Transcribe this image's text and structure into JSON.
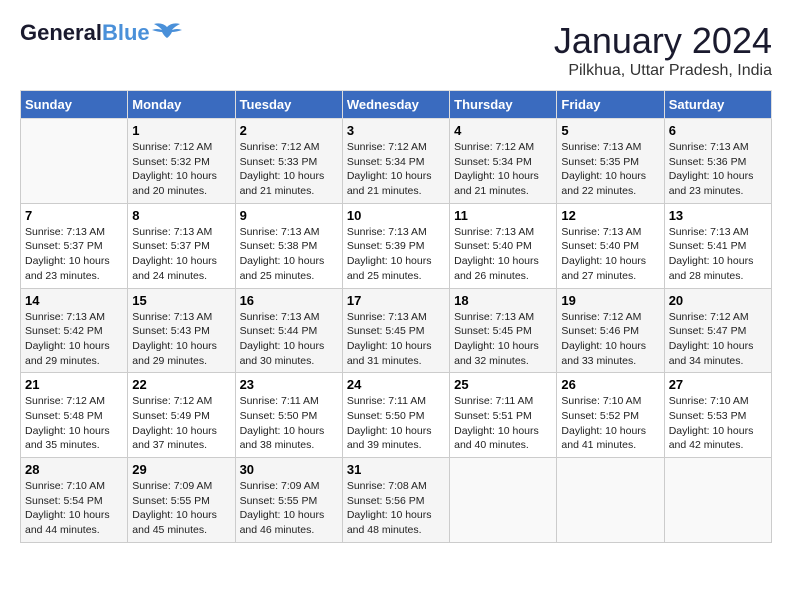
{
  "logo": {
    "part1": "General",
    "part2": "Blue"
  },
  "title": "January 2024",
  "location": "Pilkhua, Uttar Pradesh, India",
  "weekdays": [
    "Sunday",
    "Monday",
    "Tuesday",
    "Wednesday",
    "Thursday",
    "Friday",
    "Saturday"
  ],
  "weeks": [
    [
      {
        "date": "",
        "info": ""
      },
      {
        "date": "1",
        "info": "Sunrise: 7:12 AM\nSunset: 5:32 PM\nDaylight: 10 hours\nand 20 minutes."
      },
      {
        "date": "2",
        "info": "Sunrise: 7:12 AM\nSunset: 5:33 PM\nDaylight: 10 hours\nand 21 minutes."
      },
      {
        "date": "3",
        "info": "Sunrise: 7:12 AM\nSunset: 5:34 PM\nDaylight: 10 hours\nand 21 minutes."
      },
      {
        "date": "4",
        "info": "Sunrise: 7:12 AM\nSunset: 5:34 PM\nDaylight: 10 hours\nand 21 minutes."
      },
      {
        "date": "5",
        "info": "Sunrise: 7:13 AM\nSunset: 5:35 PM\nDaylight: 10 hours\nand 22 minutes."
      },
      {
        "date": "6",
        "info": "Sunrise: 7:13 AM\nSunset: 5:36 PM\nDaylight: 10 hours\nand 23 minutes."
      }
    ],
    [
      {
        "date": "7",
        "info": "Sunrise: 7:13 AM\nSunset: 5:37 PM\nDaylight: 10 hours\nand 23 minutes."
      },
      {
        "date": "8",
        "info": "Sunrise: 7:13 AM\nSunset: 5:37 PM\nDaylight: 10 hours\nand 24 minutes."
      },
      {
        "date": "9",
        "info": "Sunrise: 7:13 AM\nSunset: 5:38 PM\nDaylight: 10 hours\nand 25 minutes."
      },
      {
        "date": "10",
        "info": "Sunrise: 7:13 AM\nSunset: 5:39 PM\nDaylight: 10 hours\nand 25 minutes."
      },
      {
        "date": "11",
        "info": "Sunrise: 7:13 AM\nSunset: 5:40 PM\nDaylight: 10 hours\nand 26 minutes."
      },
      {
        "date": "12",
        "info": "Sunrise: 7:13 AM\nSunset: 5:40 PM\nDaylight: 10 hours\nand 27 minutes."
      },
      {
        "date": "13",
        "info": "Sunrise: 7:13 AM\nSunset: 5:41 PM\nDaylight: 10 hours\nand 28 minutes."
      }
    ],
    [
      {
        "date": "14",
        "info": "Sunrise: 7:13 AM\nSunset: 5:42 PM\nDaylight: 10 hours\nand 29 minutes."
      },
      {
        "date": "15",
        "info": "Sunrise: 7:13 AM\nSunset: 5:43 PM\nDaylight: 10 hours\nand 29 minutes."
      },
      {
        "date": "16",
        "info": "Sunrise: 7:13 AM\nSunset: 5:44 PM\nDaylight: 10 hours\nand 30 minutes."
      },
      {
        "date": "17",
        "info": "Sunrise: 7:13 AM\nSunset: 5:45 PM\nDaylight: 10 hours\nand 31 minutes."
      },
      {
        "date": "18",
        "info": "Sunrise: 7:13 AM\nSunset: 5:45 PM\nDaylight: 10 hours\nand 32 minutes."
      },
      {
        "date": "19",
        "info": "Sunrise: 7:12 AM\nSunset: 5:46 PM\nDaylight: 10 hours\nand 33 minutes."
      },
      {
        "date": "20",
        "info": "Sunrise: 7:12 AM\nSunset: 5:47 PM\nDaylight: 10 hours\nand 34 minutes."
      }
    ],
    [
      {
        "date": "21",
        "info": "Sunrise: 7:12 AM\nSunset: 5:48 PM\nDaylight: 10 hours\nand 35 minutes."
      },
      {
        "date": "22",
        "info": "Sunrise: 7:12 AM\nSunset: 5:49 PM\nDaylight: 10 hours\nand 37 minutes."
      },
      {
        "date": "23",
        "info": "Sunrise: 7:11 AM\nSunset: 5:50 PM\nDaylight: 10 hours\nand 38 minutes."
      },
      {
        "date": "24",
        "info": "Sunrise: 7:11 AM\nSunset: 5:50 PM\nDaylight: 10 hours\nand 39 minutes."
      },
      {
        "date": "25",
        "info": "Sunrise: 7:11 AM\nSunset: 5:51 PM\nDaylight: 10 hours\nand 40 minutes."
      },
      {
        "date": "26",
        "info": "Sunrise: 7:10 AM\nSunset: 5:52 PM\nDaylight: 10 hours\nand 41 minutes."
      },
      {
        "date": "27",
        "info": "Sunrise: 7:10 AM\nSunset: 5:53 PM\nDaylight: 10 hours\nand 42 minutes."
      }
    ],
    [
      {
        "date": "28",
        "info": "Sunrise: 7:10 AM\nSunset: 5:54 PM\nDaylight: 10 hours\nand 44 minutes."
      },
      {
        "date": "29",
        "info": "Sunrise: 7:09 AM\nSunset: 5:55 PM\nDaylight: 10 hours\nand 45 minutes."
      },
      {
        "date": "30",
        "info": "Sunrise: 7:09 AM\nSunset: 5:55 PM\nDaylight: 10 hours\nand 46 minutes."
      },
      {
        "date": "31",
        "info": "Sunrise: 7:08 AM\nSunset: 5:56 PM\nDaylight: 10 hours\nand 48 minutes."
      },
      {
        "date": "",
        "info": ""
      },
      {
        "date": "",
        "info": ""
      },
      {
        "date": "",
        "info": ""
      }
    ]
  ]
}
